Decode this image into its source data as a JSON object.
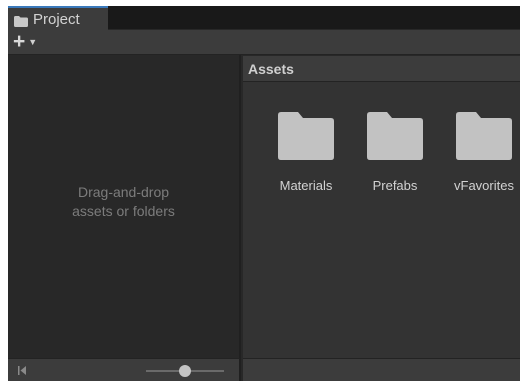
{
  "tab": {
    "label": "Project",
    "icon": "folder-icon"
  },
  "toolbar": {
    "create_icon": "plus-icon",
    "dropdown_icon": "caret-down-icon"
  },
  "left_pane": {
    "line1": "Drag-and-drop",
    "line2": "assets or folders"
  },
  "assets_panel": {
    "title": "Assets",
    "items": [
      {
        "label": "Materials",
        "icon": "folder-icon"
      },
      {
        "label": "Prefabs",
        "icon": "folder-icon"
      },
      {
        "label": "vFavorites",
        "icon": "folder-icon"
      }
    ]
  },
  "footer": {
    "first_icon": "skip-to-start-icon",
    "zoom_slider_value": 0.5
  },
  "colors": {
    "tab_accent": "#3a79bb",
    "folder": "#c2c2c2"
  }
}
